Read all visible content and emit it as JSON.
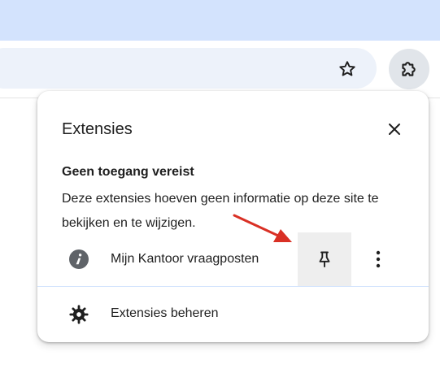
{
  "browser": {
    "bookmark_icon": "star-outline-icon",
    "extensions_icon": "puzzle-piece-icon"
  },
  "popup": {
    "title": "Extensies",
    "close_icon": "close-icon",
    "section_heading": "Geen toegang vereist",
    "description": "Deze extensies hoeven geen informatie op deze site te bekijken en te wijzigen.",
    "extensions": [
      {
        "name": "Mijn Kantoor vraagposten",
        "icon": "info-icon",
        "pin_icon": "pin-icon",
        "more_icon": "more-vert-icon"
      }
    ],
    "manage": {
      "label": "Extensies beheren",
      "icon": "gear-icon"
    }
  },
  "annotation": {
    "arrow_color": "#d93025"
  },
  "colors": {
    "tabstrip": "#d3e3fd",
    "omnibox": "#edf2fa",
    "pin_highlight": "#eeeeee"
  }
}
